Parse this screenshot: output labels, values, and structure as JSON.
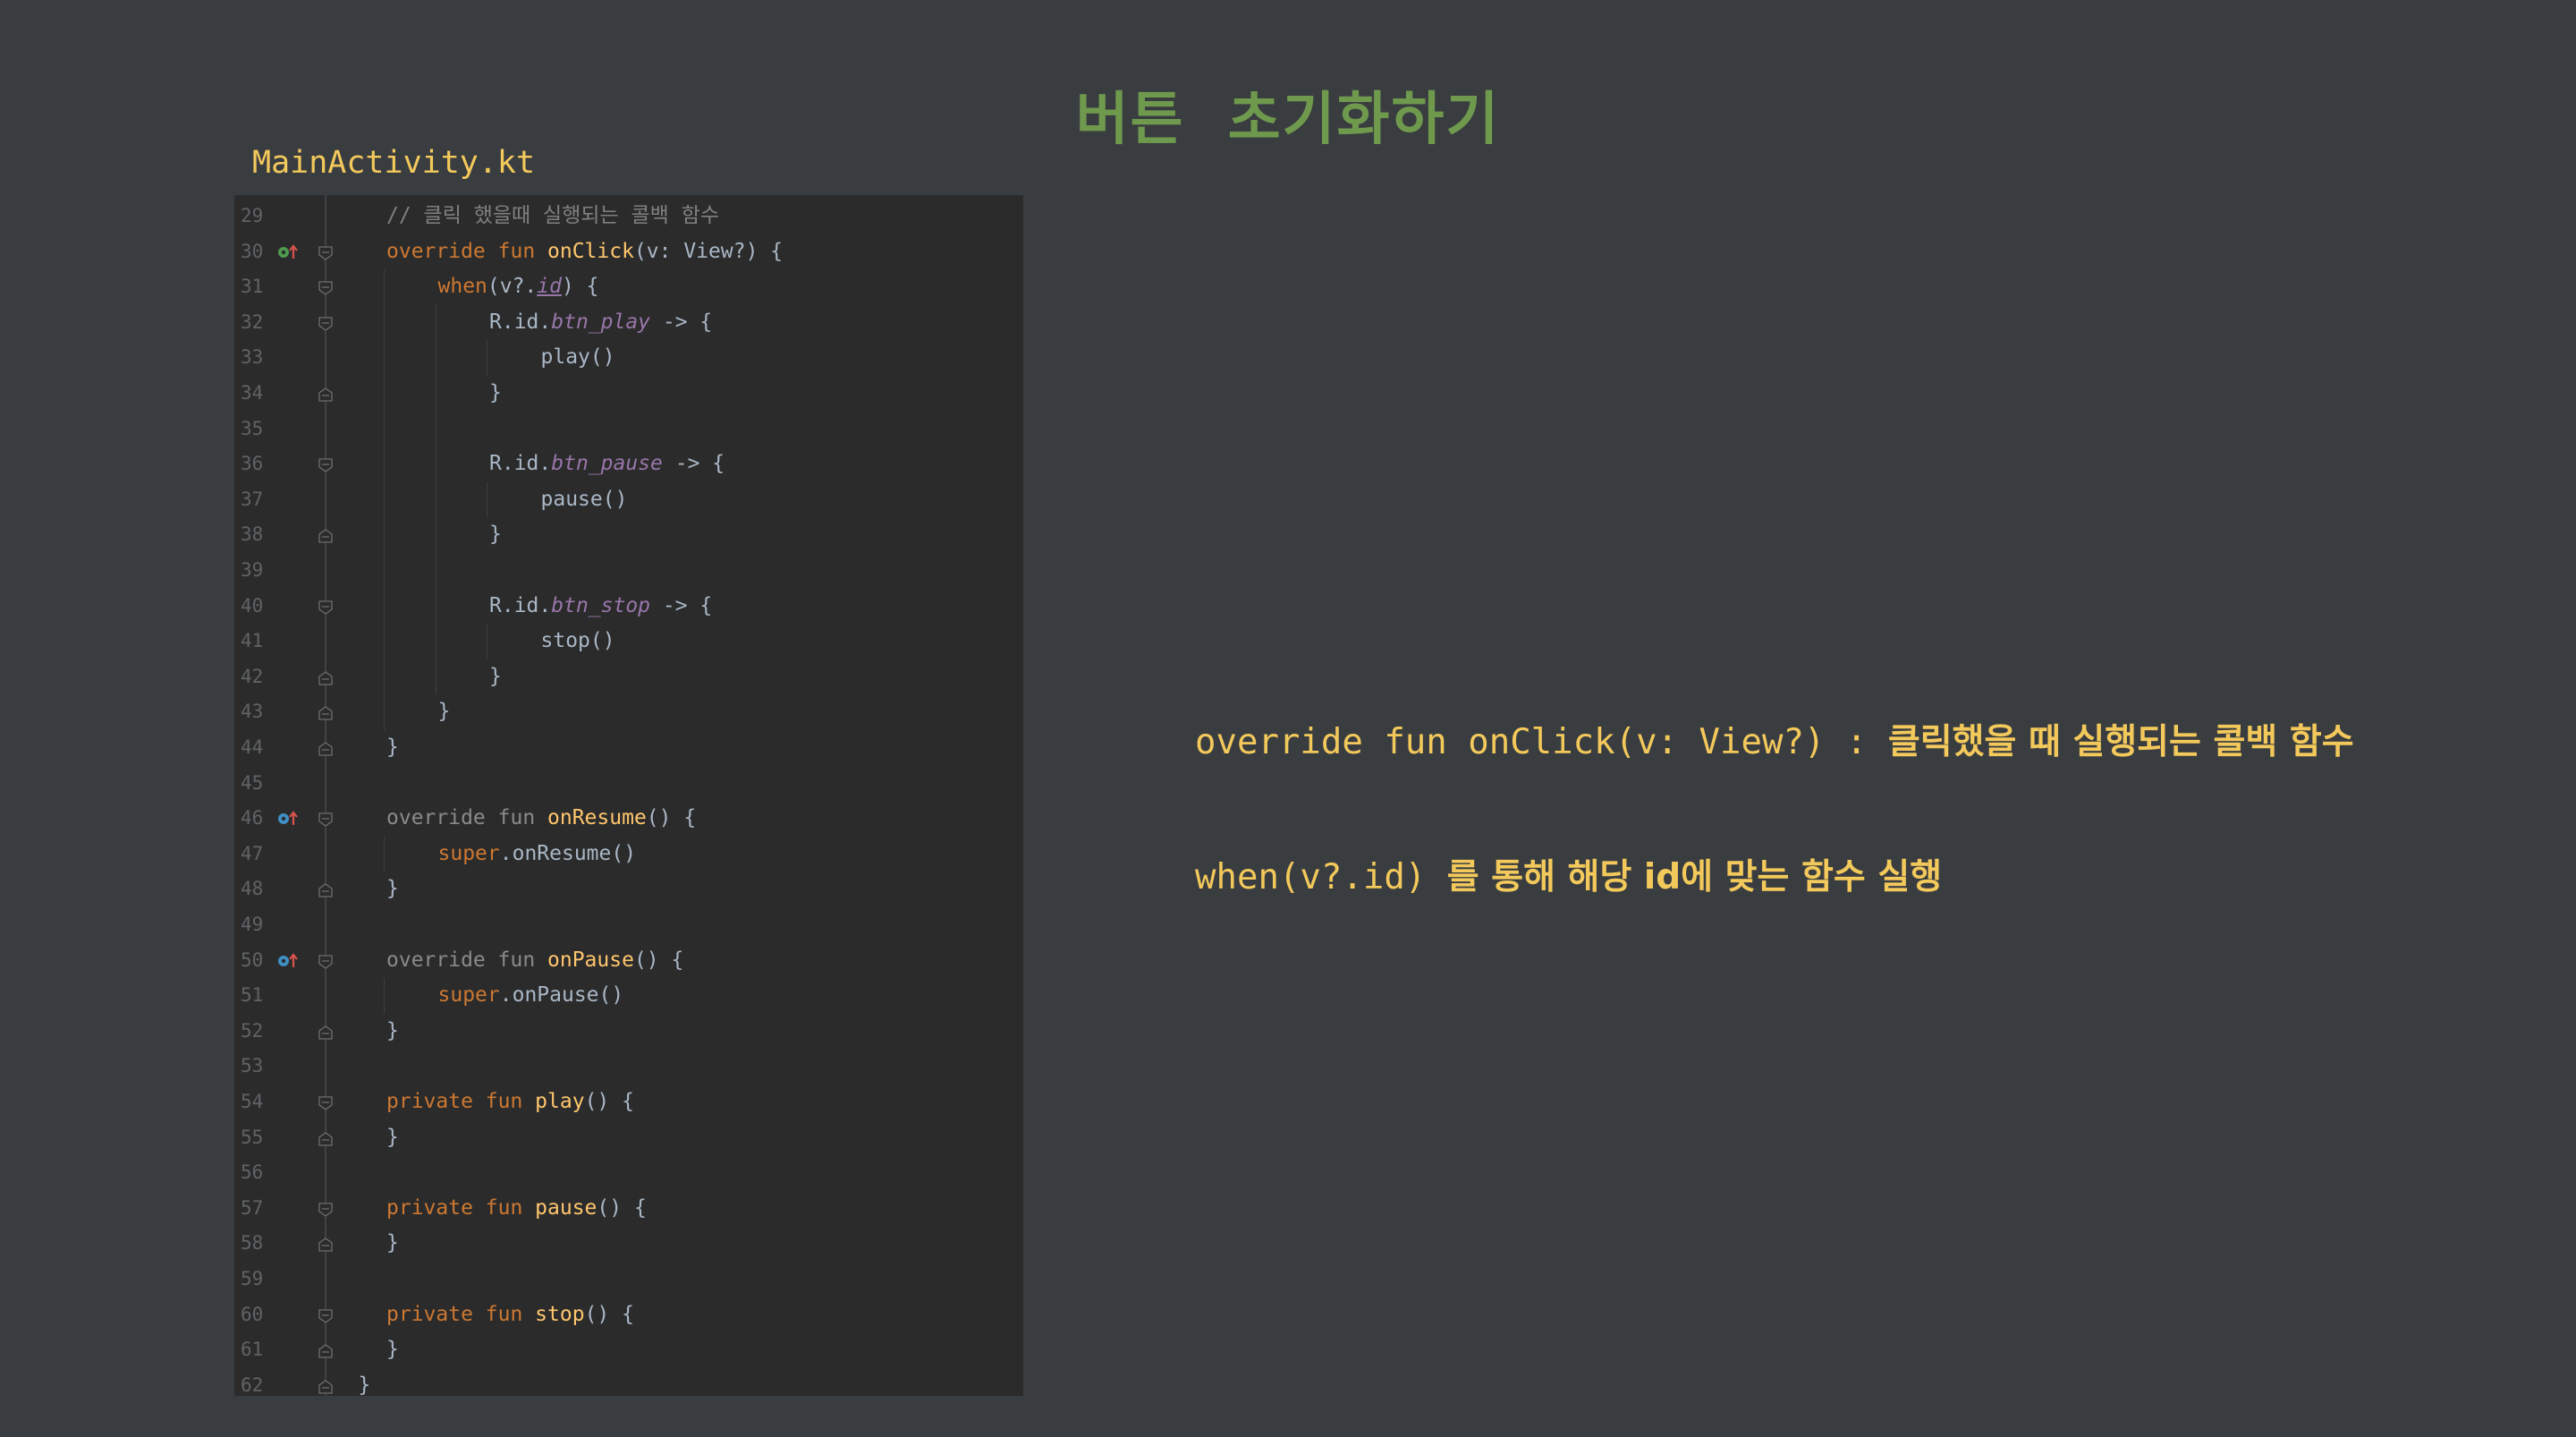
{
  "slide": {
    "title": "버튼  초기화하기",
    "file_name": "MainActivity.kt"
  },
  "colors": {
    "background": "#3a3d40",
    "editor_background": "#2b2b2b",
    "title": "#6f9a4e",
    "highlight_text": "#f3c95b",
    "keyword": "#cc7832",
    "function": "#ffc66d",
    "property": "#9876aa",
    "comment": "#808080",
    "plain": "#a9b7c6"
  },
  "editor": {
    "lines": [
      {
        "n": "29",
        "indent": 1,
        "tokens": [
          {
            "t": "// 클릭 했을때 실행되는 콜백 함수",
            "c": "cm"
          }
        ]
      },
      {
        "n": "30",
        "indent": 1,
        "icon": "override-gutter-icon-green",
        "fold": "open",
        "tokens": [
          {
            "t": "override fun ",
            "c": "kw"
          },
          {
            "t": "onClick",
            "c": "fn"
          },
          {
            "t": "(v: View?) {",
            "c": ""
          }
        ]
      },
      {
        "n": "31",
        "indent": 2,
        "fold": "open",
        "tokens": [
          {
            "t": "when",
            "c": "kw"
          },
          {
            "t": "(v?.",
            "c": ""
          },
          {
            "t": "id",
            "c": "pr-u"
          },
          {
            "t": ") {",
            "c": ""
          }
        ]
      },
      {
        "n": "32",
        "indent": 3,
        "fold": "open",
        "tokens": [
          {
            "t": "R.id.",
            "c": ""
          },
          {
            "t": "btn_play",
            "c": "pr"
          },
          {
            "t": " -> {",
            "c": ""
          }
        ]
      },
      {
        "n": "33",
        "indent": 4,
        "tokens": [
          {
            "t": "play()",
            "c": ""
          }
        ]
      },
      {
        "n": "34",
        "indent": 3,
        "fold": "close",
        "tokens": [
          {
            "t": "}",
            "c": ""
          }
        ]
      },
      {
        "n": "35",
        "indent": 0,
        "tokens": []
      },
      {
        "n": "36",
        "indent": 3,
        "fold": "open",
        "tokens": [
          {
            "t": "R.id.",
            "c": ""
          },
          {
            "t": "btn_pause",
            "c": "pr"
          },
          {
            "t": " -> {",
            "c": ""
          }
        ]
      },
      {
        "n": "37",
        "indent": 4,
        "tokens": [
          {
            "t": "pause()",
            "c": ""
          }
        ]
      },
      {
        "n": "38",
        "indent": 3,
        "fold": "close",
        "tokens": [
          {
            "t": "}",
            "c": ""
          }
        ]
      },
      {
        "n": "39",
        "indent": 0,
        "tokens": []
      },
      {
        "n": "40",
        "indent": 3,
        "fold": "open",
        "tokens": [
          {
            "t": "R.id.",
            "c": ""
          },
          {
            "t": "btn_stop",
            "c": "pr"
          },
          {
            "t": " -> {",
            "c": ""
          }
        ]
      },
      {
        "n": "41",
        "indent": 4,
        "tokens": [
          {
            "t": "stop()",
            "c": ""
          }
        ]
      },
      {
        "n": "42",
        "indent": 3,
        "fold": "close",
        "tokens": [
          {
            "t": "}",
            "c": ""
          }
        ]
      },
      {
        "n": "43",
        "indent": 2,
        "fold": "close",
        "tokens": [
          {
            "t": "}",
            "c": ""
          }
        ]
      },
      {
        "n": "44",
        "indent": 1,
        "fold": "close",
        "tokens": [
          {
            "t": "}",
            "c": ""
          }
        ]
      },
      {
        "n": "45",
        "indent": 0,
        "tokens": []
      },
      {
        "n": "46",
        "indent": 1,
        "icon": "override-gutter-icon-blue",
        "fold": "open",
        "tokens": [
          {
            "t": "override fun ",
            "c": "dim"
          },
          {
            "t": "onResume",
            "c": "fn"
          },
          {
            "t": "() {",
            "c": ""
          }
        ]
      },
      {
        "n": "47",
        "indent": 2,
        "tokens": [
          {
            "t": "super",
            "c": "kw"
          },
          {
            "t": ".onResume()",
            "c": ""
          }
        ]
      },
      {
        "n": "48",
        "indent": 1,
        "fold": "close",
        "tokens": [
          {
            "t": "}",
            "c": ""
          }
        ]
      },
      {
        "n": "49",
        "indent": 0,
        "tokens": []
      },
      {
        "n": "50",
        "indent": 1,
        "icon": "override-gutter-icon-blue",
        "fold": "open",
        "tokens": [
          {
            "t": "override fun ",
            "c": "dim"
          },
          {
            "t": "onPause",
            "c": "fn"
          },
          {
            "t": "() {",
            "c": ""
          }
        ]
      },
      {
        "n": "51",
        "indent": 2,
        "tokens": [
          {
            "t": "super",
            "c": "kw"
          },
          {
            "t": ".onPause()",
            "c": ""
          }
        ]
      },
      {
        "n": "52",
        "indent": 1,
        "fold": "close",
        "tokens": [
          {
            "t": "}",
            "c": ""
          }
        ]
      },
      {
        "n": "53",
        "indent": 0,
        "tokens": []
      },
      {
        "n": "54",
        "indent": 1,
        "fold": "open",
        "tokens": [
          {
            "t": "private fun ",
            "c": "kw"
          },
          {
            "t": "play",
            "c": "fn"
          },
          {
            "t": "() {",
            "c": ""
          }
        ]
      },
      {
        "n": "55",
        "indent": 1,
        "fold": "close",
        "tokens": [
          {
            "t": "}",
            "c": ""
          }
        ]
      },
      {
        "n": "56",
        "indent": 0,
        "tokens": []
      },
      {
        "n": "57",
        "indent": 1,
        "fold": "open",
        "tokens": [
          {
            "t": "private fun ",
            "c": "kw"
          },
          {
            "t": "pause",
            "c": "fn"
          },
          {
            "t": "() {",
            "c": ""
          }
        ]
      },
      {
        "n": "58",
        "indent": 1,
        "fold": "close",
        "tokens": [
          {
            "t": "}",
            "c": ""
          }
        ]
      },
      {
        "n": "59",
        "indent": 0,
        "tokens": []
      },
      {
        "n": "60",
        "indent": 1,
        "fold": "open",
        "tokens": [
          {
            "t": "private fun ",
            "c": "kw"
          },
          {
            "t": "stop",
            "c": "fn"
          },
          {
            "t": "() {",
            "c": ""
          }
        ]
      },
      {
        "n": "61",
        "indent": 1,
        "fold": "close",
        "tokens": [
          {
            "t": "}",
            "c": ""
          }
        ]
      },
      {
        "n": "62",
        "indent": 0,
        "fold": "close",
        "tokens": [
          {
            "t": "}",
            "c": ""
          }
        ]
      }
    ]
  },
  "descriptions": [
    {
      "code": "override fun onClick(v: View?) : ",
      "text": "클릭했을 때 실행되는 콜백 함수"
    },
    {
      "code": "when(v?.id) ",
      "text": "를 통해 해당 id에 맞는 함수 실행"
    }
  ]
}
